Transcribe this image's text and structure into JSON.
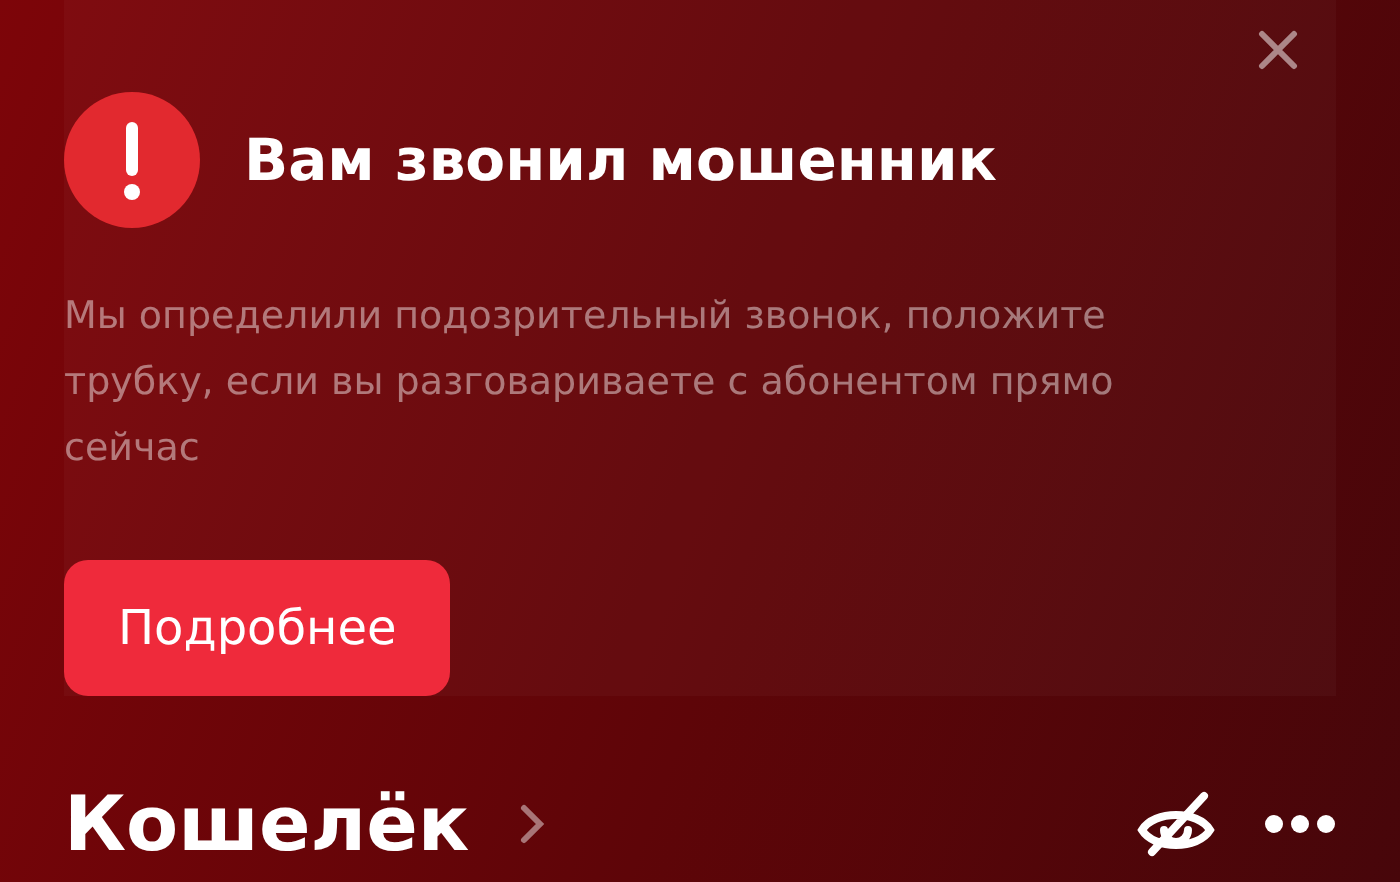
{
  "alert": {
    "title": "Вам звонил мошенник",
    "message": "Мы определили подозрительный звонок, положите трубку, если вы разговариваете с абонентом прямо сейчас",
    "button": "Подробнее"
  },
  "wallet": {
    "title": "Кошелёк"
  }
}
